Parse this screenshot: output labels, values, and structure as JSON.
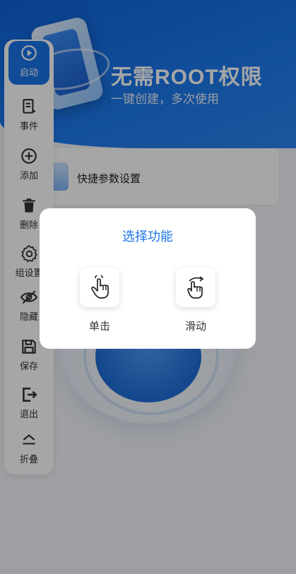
{
  "banner": {
    "title": "无需ROOT权限",
    "subtitle": "一键创建，多次使用"
  },
  "card": {
    "label": "快捷参数设置"
  },
  "sidebar": {
    "items": [
      {
        "label": "启动",
        "icon": "play-circle-icon",
        "active": true
      },
      {
        "label": "事件",
        "icon": "event-list-icon"
      },
      {
        "label": "添加",
        "icon": "add-circle-icon"
      },
      {
        "label": "删除",
        "icon": "trash-icon"
      },
      {
        "label": "组设置",
        "icon": "gear-icon"
      },
      {
        "label": "隐藏",
        "icon": "eye-off-icon"
      },
      {
        "label": "保存",
        "icon": "save-icon"
      },
      {
        "label": "退出",
        "icon": "exit-icon"
      },
      {
        "label": "折叠",
        "icon": "collapse-icon"
      }
    ]
  },
  "dialog": {
    "title": "选择功能",
    "options": [
      {
        "label": "单击",
        "icon": "tap-hand-icon"
      },
      {
        "label": "滑动",
        "icon": "swipe-hand-icon"
      }
    ]
  },
  "colors": {
    "accent": "#1a73e8",
    "banner": "#1b78ec"
  }
}
